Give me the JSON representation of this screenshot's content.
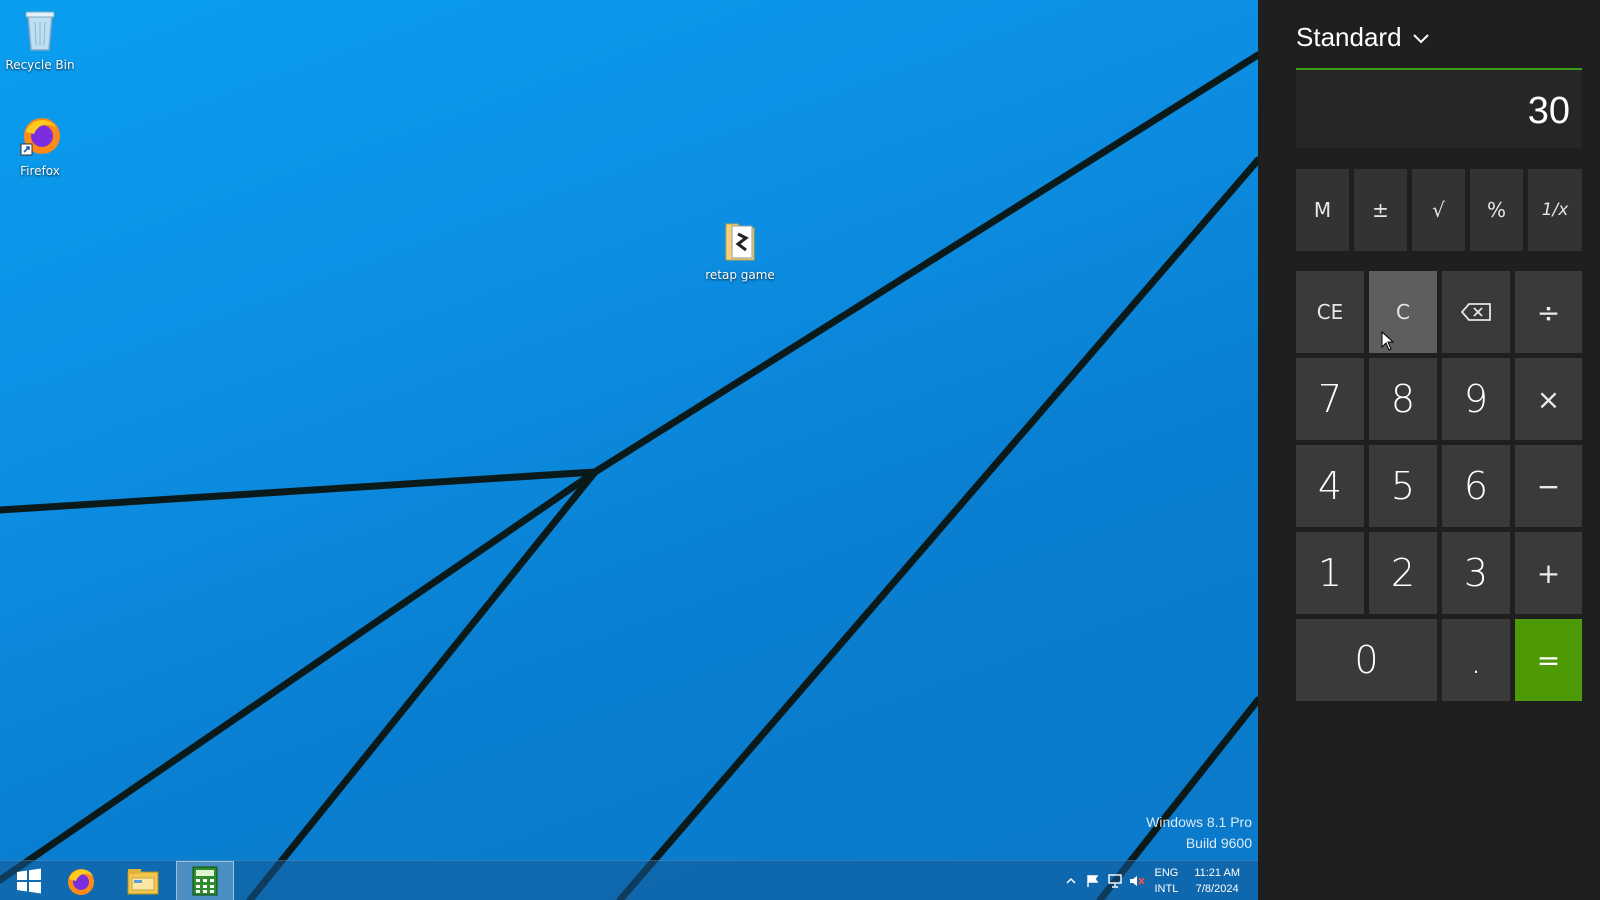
{
  "desktop": {
    "icons": [
      {
        "label": "Recycle Bin",
        "icon": "recycle-bin-icon"
      },
      {
        "label": "Firefox",
        "icon": "firefox-icon"
      },
      {
        "label": "retap game",
        "icon": "folder-icon"
      }
    ],
    "watermark": {
      "line1": "Windows 8.1 Pro",
      "line2": "Build 9600"
    }
  },
  "taskbar": {
    "buttons": [
      {
        "name": "start",
        "icon": "windows-start-icon"
      },
      {
        "name": "firefox",
        "icon": "firefox-icon"
      },
      {
        "name": "file-explorer",
        "icon": "file-explorer-icon"
      },
      {
        "name": "calculator",
        "icon": "calculator-icon",
        "active": true
      }
    ],
    "tray": {
      "lang_top": "ENG",
      "lang_bottom": "INTL",
      "time": "11:21 AM",
      "date": "7/8/2024"
    }
  },
  "calculator": {
    "mode": "Standard",
    "display": "30",
    "memory_row": [
      "M",
      "±",
      "√",
      "%",
      "1/x"
    ],
    "keys": {
      "ce": "CE",
      "c": "C",
      "divide": "÷",
      "seven": "7",
      "eight": "8",
      "nine": "9",
      "multiply": "×",
      "four": "4",
      "five": "5",
      "six": "6",
      "minus": "−",
      "one": "1",
      "two": "2",
      "three": "3",
      "plus": "+",
      "zero": "0",
      "dot": ".",
      "equals": "="
    },
    "accent": "#4e9a06"
  }
}
